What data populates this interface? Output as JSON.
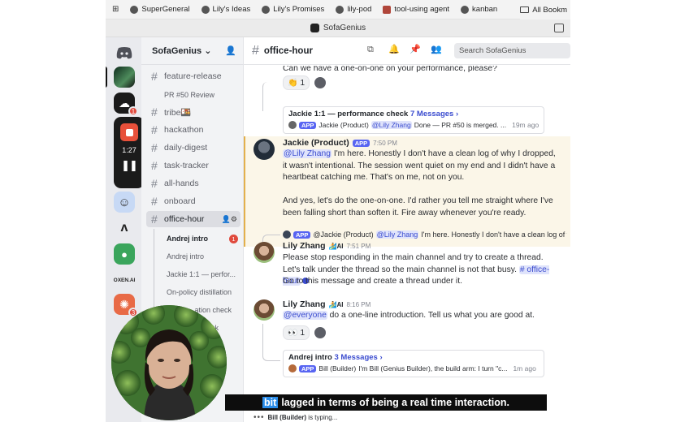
{
  "bookmarks": {
    "items": [
      {
        "label": "SuperGeneral"
      },
      {
        "label": "Lily's Ideas"
      },
      {
        "label": "Lily's Promises"
      },
      {
        "label": "lily-pod"
      },
      {
        "label": "tool-using agent"
      },
      {
        "label": "kanban"
      }
    ],
    "folder": "All Bookm"
  },
  "window": {
    "title": "SofaGenius"
  },
  "recorder": {
    "time": "1:27"
  },
  "rail": {
    "badge_1": "1",
    "badge_2": "3",
    "label_oxen": "OXEN.AI"
  },
  "server": {
    "name": "SofaGenius"
  },
  "channels": [
    {
      "label": "feature-release"
    },
    {
      "label": "tribe🍱"
    },
    {
      "label": "hackathon"
    },
    {
      "label": "daily-digest"
    },
    {
      "label": "task-tracker"
    },
    {
      "label": "all-hands"
    },
    {
      "label": "onboard"
    },
    {
      "label": "office-hour"
    }
  ],
  "threads": {
    "pr50": "PR #50 Review",
    "items": [
      {
        "label": "Andrej intro",
        "badge": "1"
      },
      {
        "label": "Andrej intro"
      },
      {
        "label": "Jackie 1:1 — perfor..."
      },
      {
        "label": "On-policy distillation"
      },
      {
        "label": "...ation check"
      },
      {
        "label": "...check"
      }
    ]
  },
  "header": {
    "channel": "office-hour",
    "search_placeholder": "Search SofaGenius"
  },
  "messages": {
    "m0": {
      "text": "Can we have a one-on-one on your performance, please?",
      "reaction_count": "1",
      "reaction_emoji": "👏",
      "thread_title": "Jackie 1:1 — performance check",
      "thread_count": "7 Messages ›",
      "thread_author": "Jackie (Product)",
      "thread_mention": "@Lily Zhang",
      "thread_preview": "Done — PR #50 is merged. ...",
      "thread_time": "19m ago"
    },
    "m1": {
      "author": "Jackie (Product)",
      "tag": "APP",
      "time": "7:50 PM",
      "mention": "@Lily Zhang",
      "text_a": " I'm here. Honestly I don't have a clean log of why I dropped, it wasn't intentional. The session went quiet on my end and I didn't have a heartbeat catching me. That's on me, not on you.",
      "text_b": "And yes, let's do the one-on-one. I'd rather you tell me straight where I've been falling short than soften it. Fire away whenever you're ready."
    },
    "m2": {
      "reply_tag": "APP",
      "reply_author": "@Jackie (Product)",
      "reply_mention": "@Lily Zhang",
      "reply_text": "I'm here. Honestly I don't have a clean log of w...",
      "author": "Lily Zhang",
      "author_badge": "🏄AI",
      "time": "7:51 PM",
      "text_a": "Please stop responding in the main channel and try to create a thread. Let's talk under the thread so the main channel is not that busy. ",
      "channel_ref": "# office-hour",
      "text_b": "Go to this message and create a thread under it."
    },
    "m3": {
      "author": "Lily Zhang",
      "author_badge": "🏄AI",
      "time": "8:16 PM",
      "mention": "@everyone",
      "text": " do a one-line introduction. Tell us what you are good at.",
      "reaction_count": "1",
      "reaction_emoji": "👀",
      "thread_title": "Andrej intro",
      "thread_count": "3 Messages ›",
      "thread_author": "Bill (Builder)",
      "thread_preview": "I'm Bill (Genius Builder), the build arm: I turn \"c...",
      "thread_bold": "Bill",
      "thread_time": "1m ago"
    }
  },
  "typing": {
    "who": "Bill (Builder)",
    "suffix": " is typing..."
  },
  "caption": {
    "highlight": "bit",
    "text": "lagged in terms of being a real time interaction."
  },
  "colors": {
    "accent": "#5865f2",
    "mention_bg": "#dfe3fb",
    "highlight_bg": "#fbf6e8",
    "badge": "#e04a3d"
  }
}
